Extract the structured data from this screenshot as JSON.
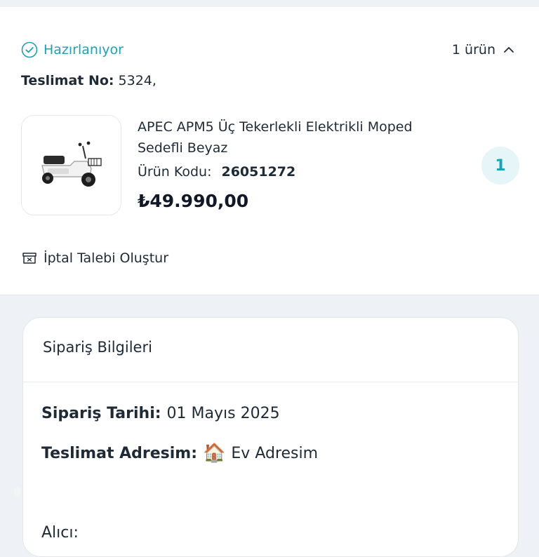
{
  "order": {
    "status": "Hazırlanıyor",
    "item_count": "1 ürün",
    "delivery_label": "Teslimat No:",
    "delivery_value": "5324,",
    "cancel_label": "İptal Talebi Oluştur"
  },
  "product": {
    "name": "APEC APM5 Üç Tekerlekli Elektrikli Moped Sedefli Beyaz",
    "code_label": "Ürün Kodu:",
    "code_value": "26051272",
    "price": "₺49.990,00",
    "quantity": "1"
  },
  "info": {
    "title": "Sipariş Bilgileri",
    "date_label": "Sipariş Tarihi:",
    "date_value": "01 Mayıs 2025",
    "address_label": "Teslimat Adresim:",
    "address_icon": "🏠",
    "address_value": "Ev Adresim",
    "recipient_label": "Alıcı:"
  },
  "colors": {
    "accent": "#1aa3b5",
    "accent_bg": "#e6f6f8",
    "text": "#1f2a37",
    "background": "#eef1f5"
  },
  "icons": {
    "status": "check-circle-icon",
    "collapse": "chevron-up-icon",
    "cancel": "store-box-icon",
    "address": "house-icon"
  }
}
